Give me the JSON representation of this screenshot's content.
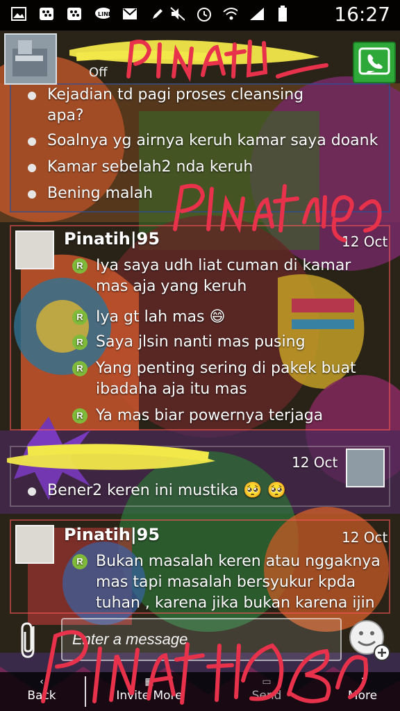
{
  "status_bar": {
    "time": "16:27",
    "left_icons": [
      "gallery-icon",
      "bbm-icon",
      "bbm-icon",
      "line-icon",
      "gmail-icon",
      "pencil-icon"
    ],
    "right_icons": [
      "mute-icon",
      "alarm-icon",
      "wifi-icon",
      "signal-icon",
      "battery-icon"
    ]
  },
  "header": {
    "status": "Off",
    "call_icon": "phone-icon"
  },
  "messages": {
    "group1": {
      "lines": [
        "Kejadian td pagi proses cleansing apa?",
        "Soalnya yg airnya keruh kamar saya doank",
        "Kamar sebelah2 nda keruh",
        "Bening malah"
      ],
      "line1a": "Kejadian td pagi proses cleansing",
      "line1b": "apa?"
    },
    "group2": {
      "sender": "Pinatih|95",
      "date": "12 Oct",
      "badge": "R",
      "l1a": "Iya saya udh liat cuman di kamar",
      "l1b": "mas aja yang keruh",
      "l2": "Iya gt lah mas 😄",
      "l3": "Saya jlsin nanti mas pusing",
      "l4a": "Yang penting sering di pakek buat",
      "l4b": "ibadaha aja itu mas",
      "l5": "Ya mas biar powernya terjaga"
    },
    "group3": {
      "date": "12 Oct",
      "line": "Bener2 keren ini mustika 🥺 🥺"
    },
    "group4": {
      "sender": "Pinatih|95",
      "date": "12 Oct",
      "badge": "R",
      "l1a": "Bukan masalah keren atau nggaknya",
      "l1b": "mas tapi masalah bersyukur kpda",
      "l1c": "tuhan , karena jika bukan karena ijin"
    }
  },
  "composer": {
    "placeholder": "Enter a message",
    "attach_icon": "paperclip-icon",
    "emoji_icon": "smiley-add-icon"
  },
  "bottom_bar": {
    "back": "Back",
    "invite": "Invite More",
    "send": "Send",
    "more": "More"
  },
  "colors": {
    "accent_green": "#7fba3b",
    "call_green": "#2fa83a",
    "scribble_red": "#e8314a",
    "scribble_yellow": "#f2e84a"
  }
}
